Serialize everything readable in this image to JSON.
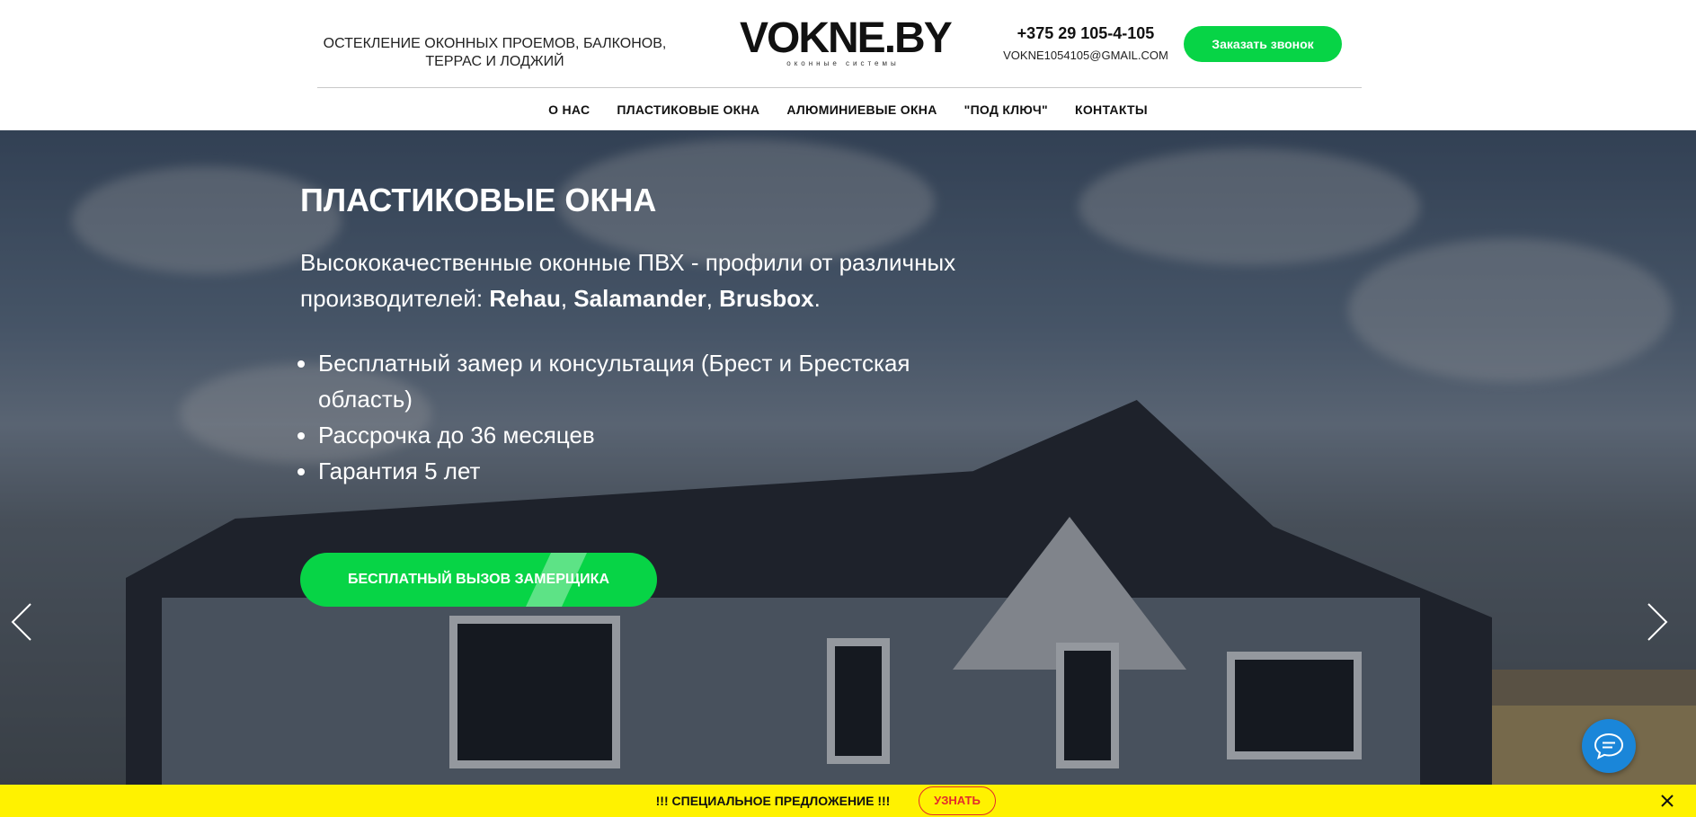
{
  "header": {
    "tagline": "ОСТЕКЛЕНИЕ ОКОННЫХ ПРОЕМОВ, БАЛКОНОВ, ТЕРРАС И ЛОДЖИЙ",
    "logo_main": "VOKNE.BY",
    "logo_sub": "оконные системы",
    "phone": "+375 29 105-4-105",
    "email": "VOKNE1054105@GMAIL.COM",
    "call_button": "Заказать звонок"
  },
  "nav": {
    "items": [
      "О НАС",
      "ПЛАСТИКОВЫЕ ОКНА",
      "АЛЮМИНИЕВЫЕ ОКНА",
      "\"ПОД КЛЮЧ\"",
      "КОНТАКТЫ"
    ]
  },
  "hero": {
    "title": "ПЛАСТИКОВЫЕ ОКНА",
    "text_prefix": "Высококачественные оконные ПВХ - профили от различных производителей: ",
    "brands": [
      "Rehau",
      "Salamander",
      "Brusbox"
    ],
    "separator": ", ",
    "text_suffix": ".",
    "bullets": [
      "Бесплатный замер и консультация (Брест и Брестская область)",
      "Рассрочка до 36 месяцев",
      "Гарантия 5 лет"
    ],
    "cta": "БЕСПЛАТНЫЙ ВЫЗОВ ЗАМЕРЩИКА"
  },
  "promo": {
    "text": "!!! СПЕЦИАЛЬНОЕ ПРЕДЛОЖЕНИЕ !!!",
    "button": "УЗНАТЬ"
  },
  "icons": {
    "prev": "chevron-left-icon",
    "next": "chevron-right-icon",
    "chat": "chat-bubble-icon",
    "close": "close-icon"
  },
  "colors": {
    "accent_green": "#07d446",
    "promo_yellow": "#fff200",
    "promo_red": "#e32b2b",
    "chat_blue": "#1a86d9"
  }
}
